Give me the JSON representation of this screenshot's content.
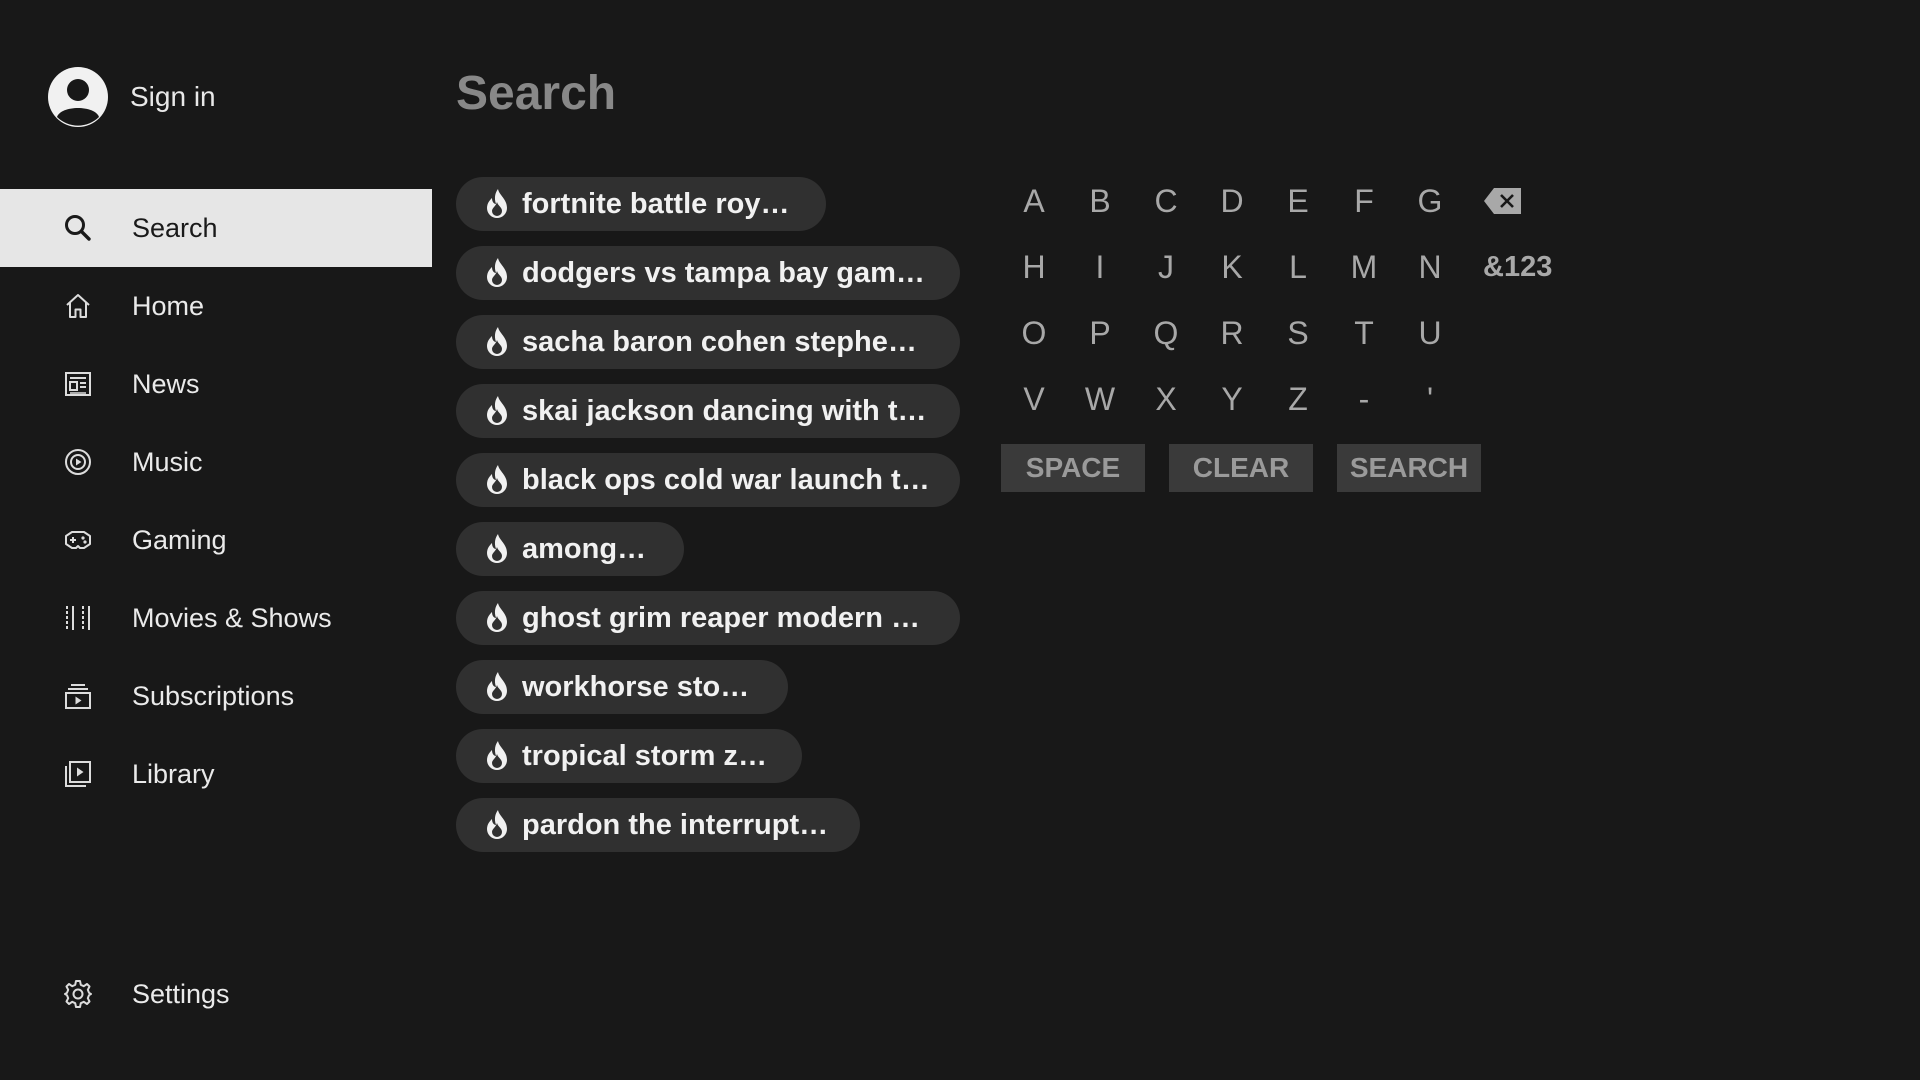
{
  "header": {
    "signin_label": "Sign in"
  },
  "sidebar": {
    "items": [
      {
        "label": "Search",
        "icon": "search-icon",
        "active": true
      },
      {
        "label": "Home",
        "icon": "home-icon"
      },
      {
        "label": "News",
        "icon": "news-icon"
      },
      {
        "label": "Music",
        "icon": "music-icon"
      },
      {
        "label": "Gaming",
        "icon": "gaming-icon"
      },
      {
        "label": "Movies & Shows",
        "icon": "film-icon"
      },
      {
        "label": "Subscriptions",
        "icon": "subscriptions-icon"
      },
      {
        "label": "Library",
        "icon": "library-icon"
      }
    ],
    "settings_label": "Settings"
  },
  "main": {
    "title": "Search",
    "suggestions": [
      "fortnite battle royale",
      "dodgers vs tampa bay game ...",
      "sacha baron cohen stephen ...",
      "skai jackson dancing with th...",
      "black ops cold war launch tr...",
      "among us",
      "ghost grim reaper modern w...",
      "workhorse stocks",
      "tropical storm zeta",
      "pardon the interruption"
    ]
  },
  "keyboard": {
    "rows": [
      [
        "A",
        "B",
        "C",
        "D",
        "E",
        "F",
        "G"
      ],
      [
        "H",
        "I",
        "J",
        "K",
        "L",
        "M",
        "N"
      ],
      [
        "O",
        "P",
        "Q",
        "R",
        "S",
        "T",
        "U"
      ],
      [
        "V",
        "W",
        "X",
        "Y",
        "Z",
        "-",
        "'"
      ]
    ],
    "backspace_icon": "backspace-icon",
    "symbols_label": "&123",
    "space_label": "SPACE",
    "clear_label": "CLEAR",
    "search_label": "SEARCH"
  },
  "colors": {
    "background": "#181818",
    "active_nav_bg": "#e6e6e6",
    "chip_bg": "#303030",
    "key_text": "#a8a8a8",
    "title_text": "#888888"
  }
}
